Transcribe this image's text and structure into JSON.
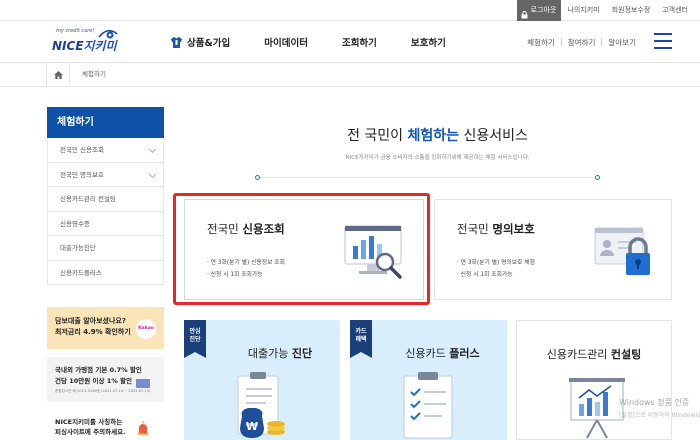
{
  "topbar": {
    "login": "로그아웃",
    "links": [
      "나의지키미",
      "회원정보수정",
      "고객센터"
    ]
  },
  "logo": {
    "tagline": "my credit care!",
    "brand": "NICE",
    "brand2": "지키미"
  },
  "gnb": [
    {
      "label": "상품&가입"
    },
    {
      "label": "마이데이터"
    },
    {
      "label": "조회하기"
    },
    {
      "label": "보호하기"
    }
  ],
  "util": [
    "체험하기",
    "참여하기",
    "알아보기"
  ],
  "breadcrumb": {
    "current": "체험하기"
  },
  "lnb": {
    "title": "체험하기",
    "items": [
      {
        "label": "전국민 신용조회"
      },
      {
        "label": "전국민 명의보호"
      },
      {
        "label": "신용카드관리 컨설팅"
      },
      {
        "label": "신용영수증"
      },
      {
        "label": "대출가능진단"
      },
      {
        "label": "신용카드플러스"
      }
    ]
  },
  "banners": {
    "b1": {
      "line1": "담보대출 알아보셨나요?",
      "line2": "최저금리 4.9% 확인하기",
      "logo": "Kakao"
    },
    "b2": {
      "line1": "국내외 가맹점 기본 0.7% 할인",
      "line2": "건당 10만원 이상 1% 할인",
      "small": "준법감시인 제 2021-0126호 (2021.07.14 ~ 2022.07.13)"
    },
    "b3": {
      "line1": "NICE지키미를 사칭하는",
      "line2": "피싱사이트에 주의하세요."
    }
  },
  "main": {
    "title_pre": "전 국민이 ",
    "title_em": "체험하는",
    "title_post": " 신용서비스",
    "desc": "NICE지키미가 금융 소비자의 소통을 강화하기위해 제공하는 체험 서비스입니다."
  },
  "box1": {
    "title_pre": "전국민 ",
    "title_em": "신용조회",
    "bullets": [
      "· 연 3회(분기 별) 신용정보 조회",
      "· 신청 시 1회 조회가능"
    ]
  },
  "box2": {
    "title_pre": "전국민 ",
    "title_em": "명의보호",
    "bullets": [
      "· 연 3회(분기 별) 명의보호 체험",
      "· 신청 시 1회 조회가능"
    ]
  },
  "cards": [
    {
      "tag1": "안심",
      "tag2": "진단",
      "title_pre": "대출가능 ",
      "title_em": "진단"
    },
    {
      "tag1": "카드",
      "tag2": "혜택",
      "title_pre": "신용카드 ",
      "title_em": "플러스"
    },
    {
      "title_pre": "신용카드관리 ",
      "title_em": "컨설팅"
    }
  ],
  "watermark": {
    "line1": "Windows 정품 인증",
    "line2": "[설정]으로 이동하여 Windows를"
  },
  "colors": {
    "brand_blue": "#0d52a8",
    "accent_red": "#e8262a",
    "card_bg": "#d8eefc"
  }
}
